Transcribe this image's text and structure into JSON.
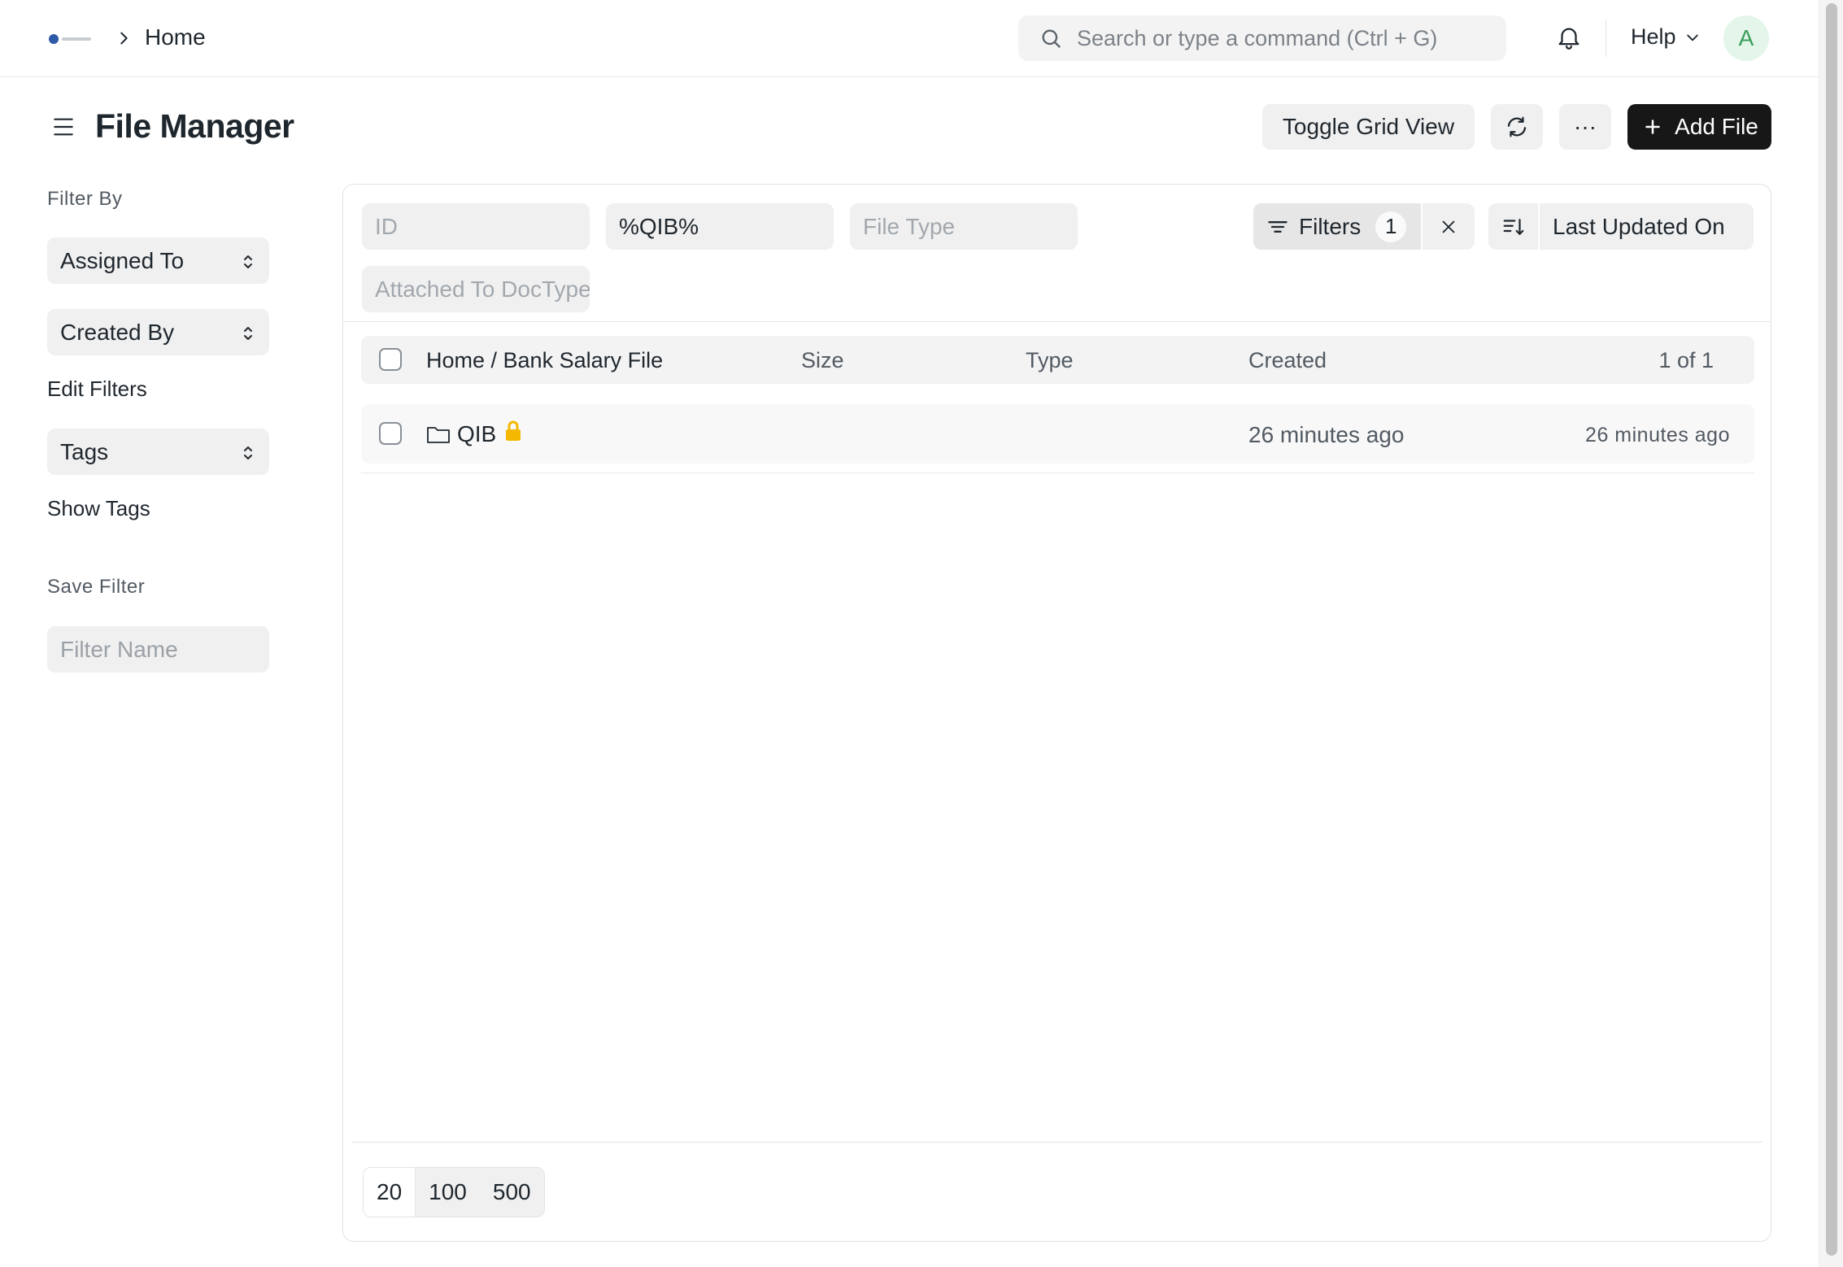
{
  "navbar": {
    "breadcrumb_home": "Home",
    "search_placeholder": "Search or type a command (Ctrl + G)",
    "help_label": "Help",
    "avatar_initial": "A",
    "avatar_color": "#3a9e5c"
  },
  "page": {
    "title": "File Manager",
    "toggle_grid_label": "Toggle Grid View",
    "add_file_label": "Add File",
    "more_label": "···"
  },
  "sidebar": {
    "filter_by_label": "Filter By",
    "assigned_to_label": "Assigned To",
    "created_by_label": "Created By",
    "edit_filters_label": "Edit Filters",
    "tags_label": "Tags",
    "show_tags_label": "Show Tags",
    "save_filter_label": "Save Filter",
    "filter_name_placeholder": "Filter Name"
  },
  "filters": {
    "id_placeholder": "ID",
    "name_value": "%QIB%",
    "file_type_placeholder": "File Type",
    "attached_to_placeholder": "Attached To DocType",
    "filters_label": "Filters",
    "filters_count": "1",
    "sort_field_label": "Last Updated On"
  },
  "table": {
    "header": {
      "name": "Home / Bank Salary File",
      "size": "Size",
      "type": "Type",
      "created": "Created",
      "count": "1 of 1"
    },
    "rows": [
      {
        "name": "QIB",
        "icon": "folder-icon",
        "locked": true,
        "created": "26 minutes ago",
        "modified": "26 minutes ago"
      }
    ]
  },
  "pagination": {
    "options": [
      "20",
      "100",
      "500"
    ],
    "selected": "20"
  },
  "colors": {
    "primary_button": "#171717",
    "lock": "#f5b800"
  }
}
